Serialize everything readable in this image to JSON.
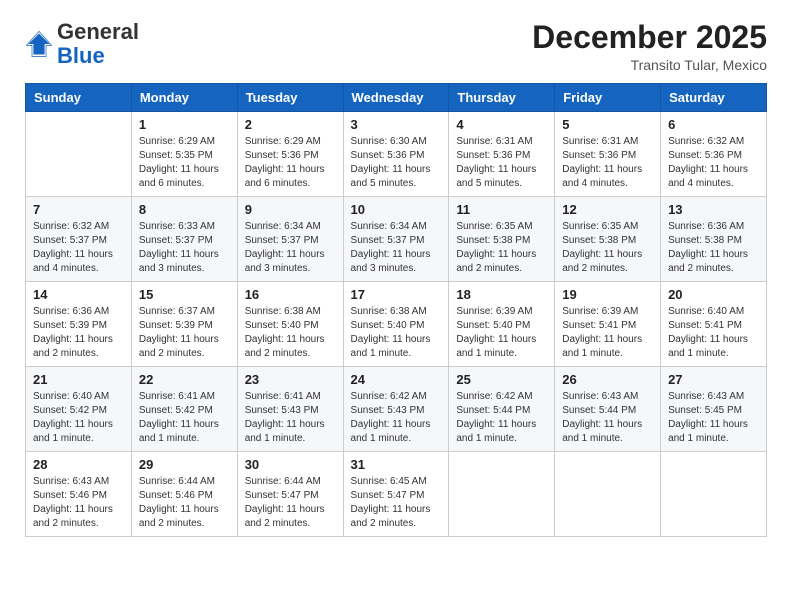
{
  "header": {
    "logo_general": "General",
    "logo_blue": "Blue",
    "title": "December 2025",
    "subtitle": "Transito Tular, Mexico"
  },
  "weekdays": [
    "Sunday",
    "Monday",
    "Tuesday",
    "Wednesday",
    "Thursday",
    "Friday",
    "Saturday"
  ],
  "weeks": [
    [
      {
        "day": "",
        "sunrise": "",
        "sunset": "",
        "daylight": ""
      },
      {
        "day": "1",
        "sunrise": "Sunrise: 6:29 AM",
        "sunset": "Sunset: 5:35 PM",
        "daylight": "Daylight: 11 hours and 6 minutes."
      },
      {
        "day": "2",
        "sunrise": "Sunrise: 6:29 AM",
        "sunset": "Sunset: 5:36 PM",
        "daylight": "Daylight: 11 hours and 6 minutes."
      },
      {
        "day": "3",
        "sunrise": "Sunrise: 6:30 AM",
        "sunset": "Sunset: 5:36 PM",
        "daylight": "Daylight: 11 hours and 5 minutes."
      },
      {
        "day": "4",
        "sunrise": "Sunrise: 6:31 AM",
        "sunset": "Sunset: 5:36 PM",
        "daylight": "Daylight: 11 hours and 5 minutes."
      },
      {
        "day": "5",
        "sunrise": "Sunrise: 6:31 AM",
        "sunset": "Sunset: 5:36 PM",
        "daylight": "Daylight: 11 hours and 4 minutes."
      },
      {
        "day": "6",
        "sunrise": "Sunrise: 6:32 AM",
        "sunset": "Sunset: 5:36 PM",
        "daylight": "Daylight: 11 hours and 4 minutes."
      }
    ],
    [
      {
        "day": "7",
        "sunrise": "Sunrise: 6:32 AM",
        "sunset": "Sunset: 5:37 PM",
        "daylight": "Daylight: 11 hours and 4 minutes."
      },
      {
        "day": "8",
        "sunrise": "Sunrise: 6:33 AM",
        "sunset": "Sunset: 5:37 PM",
        "daylight": "Daylight: 11 hours and 3 minutes."
      },
      {
        "day": "9",
        "sunrise": "Sunrise: 6:34 AM",
        "sunset": "Sunset: 5:37 PM",
        "daylight": "Daylight: 11 hours and 3 minutes."
      },
      {
        "day": "10",
        "sunrise": "Sunrise: 6:34 AM",
        "sunset": "Sunset: 5:37 PM",
        "daylight": "Daylight: 11 hours and 3 minutes."
      },
      {
        "day": "11",
        "sunrise": "Sunrise: 6:35 AM",
        "sunset": "Sunset: 5:38 PM",
        "daylight": "Daylight: 11 hours and 2 minutes."
      },
      {
        "day": "12",
        "sunrise": "Sunrise: 6:35 AM",
        "sunset": "Sunset: 5:38 PM",
        "daylight": "Daylight: 11 hours and 2 minutes."
      },
      {
        "day": "13",
        "sunrise": "Sunrise: 6:36 AM",
        "sunset": "Sunset: 5:38 PM",
        "daylight": "Daylight: 11 hours and 2 minutes."
      }
    ],
    [
      {
        "day": "14",
        "sunrise": "Sunrise: 6:36 AM",
        "sunset": "Sunset: 5:39 PM",
        "daylight": "Daylight: 11 hours and 2 minutes."
      },
      {
        "day": "15",
        "sunrise": "Sunrise: 6:37 AM",
        "sunset": "Sunset: 5:39 PM",
        "daylight": "Daylight: 11 hours and 2 minutes."
      },
      {
        "day": "16",
        "sunrise": "Sunrise: 6:38 AM",
        "sunset": "Sunset: 5:40 PM",
        "daylight": "Daylight: 11 hours and 2 minutes."
      },
      {
        "day": "17",
        "sunrise": "Sunrise: 6:38 AM",
        "sunset": "Sunset: 5:40 PM",
        "daylight": "Daylight: 11 hours and 1 minute."
      },
      {
        "day": "18",
        "sunrise": "Sunrise: 6:39 AM",
        "sunset": "Sunset: 5:40 PM",
        "daylight": "Daylight: 11 hours and 1 minute."
      },
      {
        "day": "19",
        "sunrise": "Sunrise: 6:39 AM",
        "sunset": "Sunset: 5:41 PM",
        "daylight": "Daylight: 11 hours and 1 minute."
      },
      {
        "day": "20",
        "sunrise": "Sunrise: 6:40 AM",
        "sunset": "Sunset: 5:41 PM",
        "daylight": "Daylight: 11 hours and 1 minute."
      }
    ],
    [
      {
        "day": "21",
        "sunrise": "Sunrise: 6:40 AM",
        "sunset": "Sunset: 5:42 PM",
        "daylight": "Daylight: 11 hours and 1 minute."
      },
      {
        "day": "22",
        "sunrise": "Sunrise: 6:41 AM",
        "sunset": "Sunset: 5:42 PM",
        "daylight": "Daylight: 11 hours and 1 minute."
      },
      {
        "day": "23",
        "sunrise": "Sunrise: 6:41 AM",
        "sunset": "Sunset: 5:43 PM",
        "daylight": "Daylight: 11 hours and 1 minute."
      },
      {
        "day": "24",
        "sunrise": "Sunrise: 6:42 AM",
        "sunset": "Sunset: 5:43 PM",
        "daylight": "Daylight: 11 hours and 1 minute."
      },
      {
        "day": "25",
        "sunrise": "Sunrise: 6:42 AM",
        "sunset": "Sunset: 5:44 PM",
        "daylight": "Daylight: 11 hours and 1 minute."
      },
      {
        "day": "26",
        "sunrise": "Sunrise: 6:43 AM",
        "sunset": "Sunset: 5:44 PM",
        "daylight": "Daylight: 11 hours and 1 minute."
      },
      {
        "day": "27",
        "sunrise": "Sunrise: 6:43 AM",
        "sunset": "Sunset: 5:45 PM",
        "daylight": "Daylight: 11 hours and 1 minute."
      }
    ],
    [
      {
        "day": "28",
        "sunrise": "Sunrise: 6:43 AM",
        "sunset": "Sunset: 5:46 PM",
        "daylight": "Daylight: 11 hours and 2 minutes."
      },
      {
        "day": "29",
        "sunrise": "Sunrise: 6:44 AM",
        "sunset": "Sunset: 5:46 PM",
        "daylight": "Daylight: 11 hours and 2 minutes."
      },
      {
        "day": "30",
        "sunrise": "Sunrise: 6:44 AM",
        "sunset": "Sunset: 5:47 PM",
        "daylight": "Daylight: 11 hours and 2 minutes."
      },
      {
        "day": "31",
        "sunrise": "Sunrise: 6:45 AM",
        "sunset": "Sunset: 5:47 PM",
        "daylight": "Daylight: 11 hours and 2 minutes."
      },
      {
        "day": "",
        "sunrise": "",
        "sunset": "",
        "daylight": ""
      },
      {
        "day": "",
        "sunrise": "",
        "sunset": "",
        "daylight": ""
      },
      {
        "day": "",
        "sunrise": "",
        "sunset": "",
        "daylight": ""
      }
    ]
  ]
}
